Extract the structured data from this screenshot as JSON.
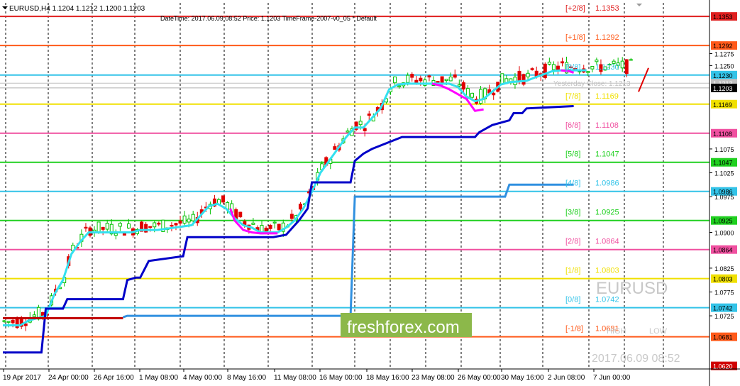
{
  "header": {
    "symbol_line": "EURUSD,H4  1.1204 1.1212 1.1200 1.1203",
    "info_line": "DateTime: 2017.06.09 08:52    Price: 1.1203    TimeFrame-2007-v0_05    *    Default"
  },
  "watermark": {
    "symbol": "EURUSD",
    "high_label": "HIGH",
    "low_label": "LOW",
    "datetime": "2017.06.09 08:52",
    "brand": "freshforex.com"
  },
  "colors": {
    "background": "#ffffff",
    "candle_up": "#00c000",
    "candle_down": "#e00000",
    "cyan_line": "#33e0f0",
    "magenta_line": "#ff00ff",
    "navy_line": "#0000c8",
    "mid_blue_line": "#3090e0",
    "red_line": "#c00000",
    "brand_bg": "#8cb84a"
  },
  "chart_data": {
    "type": "candlestick",
    "symbol": "EURUSD",
    "timeframe": "H4",
    "ylim": [
      1.062,
      1.1365
    ],
    "y_ticks": [
      "1.1353",
      "1.1275",
      "1.1250",
      "1.1213",
      "1.1203",
      "1.1169",
      "1.1108",
      "1.1075",
      "1.1047",
      "1.1025",
      "1.0986",
      "1.0975",
      "1.0925",
      "1.0900",
      "1.0864",
      "1.0825",
      "1.0803",
      "1.0775",
      "1.0742",
      "1.0725",
      "1.0681",
      "1.0620"
    ],
    "x_labels": [
      "19 Apr 2017",
      "24 Apr 00:00",
      "26 Apr 16:00",
      "1 May 08:00",
      "4 May 00:00",
      "8 May 16:00",
      "11 May 08:00",
      "16 May 00:00",
      "18 May 16:00",
      "23 May 08:00",
      "26 May 00:00",
      "30 May 16:00",
      "2 Jun 08:00",
      "7 Jun 00:00"
    ],
    "murrey_levels": [
      {
        "label": "[+2/8]",
        "value": "1.1353",
        "price": 1.1353,
        "color": "#e02020"
      },
      {
        "label": "[+1/8]",
        "value": "1.1292",
        "price": 1.1292,
        "color": "#ff5a1a"
      },
      {
        "label": "[8/8]",
        "value": "1.1230",
        "price": 1.123,
        "color": "#33c3e8"
      },
      {
        "label": "[7/8]",
        "value": "1.1169",
        "price": 1.1169,
        "color": "#f0e000"
      },
      {
        "label": "[6/8]",
        "value": "1.1108",
        "price": 1.1108,
        "color": "#f050a0"
      },
      {
        "label": "[5/8]",
        "value": "1.1047",
        "price": 1.1047,
        "color": "#20d020"
      },
      {
        "label": "[4/8]",
        "value": "1.0986",
        "price": 1.0986,
        "color": "#33c3e8"
      },
      {
        "label": "[3/8]",
        "value": "1.0925",
        "price": 1.0925,
        "color": "#20d020"
      },
      {
        "label": "[2/8]",
        "value": "1.0864",
        "price": 1.0864,
        "color": "#f050a0"
      },
      {
        "label": "[1/8]",
        "value": "1.0803",
        "price": 1.0803,
        "color": "#f0e000"
      },
      {
        "label": "[0/8]",
        "value": "1.0742",
        "price": 1.0742,
        "color": "#33c3e8"
      },
      {
        "label": "[-1/8]",
        "value": "1.0681",
        "price": 1.0681,
        "color": "#ff5a1a"
      }
    ],
    "yesterday_close_label": "Yesterday Close: 1.1213",
    "yesterday_close": 1.1213,
    "current_price": 1.1203,
    "series": [
      {
        "color_key": "cyan_line",
        "points": [
          [
            0,
            1.0705
          ],
          [
            4,
            1.0705
          ],
          [
            6,
            1.0715
          ],
          [
            8,
            1.072
          ],
          [
            10,
            1.0725
          ],
          [
            12,
            1.077
          ],
          [
            14,
            1.08
          ],
          [
            16,
            1.0855
          ],
          [
            18,
            1.088
          ],
          [
            20,
            1.09
          ],
          [
            22,
            1.09
          ],
          [
            30,
            1.09
          ],
          [
            32,
            1.0905
          ],
          [
            36,
            1.0905
          ],
          [
            40,
            1.091
          ],
          [
            44,
            1.0915
          ],
          [
            46,
            1.0935
          ],
          [
            48,
            1.0955
          ],
          [
            50,
            1.096
          ],
          [
            52,
            1.095
          ],
          [
            54,
            1.093
          ],
          [
            56,
            1.0915
          ],
          [
            58,
            1.091
          ],
          [
            60,
            1.09
          ],
          [
            64,
            1.09
          ],
          [
            66,
            1.091
          ],
          [
            68,
            1.0925
          ],
          [
            70,
            1.095
          ],
          [
            72,
            1.0985
          ],
          [
            74,
            1.1025
          ],
          [
            76,
            1.105
          ],
          [
            78,
            1.1075
          ],
          [
            80,
            1.11
          ],
          [
            82,
            1.112
          ],
          [
            84,
            1.112
          ],
          [
            86,
            1.114
          ],
          [
            88,
            1.116
          ],
          [
            90,
            1.12
          ],
          [
            92,
            1.121
          ],
          [
            94,
            1.1212
          ],
          [
            100,
            1.1212
          ],
          [
            104,
            1.1212
          ],
          [
            106,
            1.1205
          ],
          [
            108,
            1.1185
          ],
          [
            110,
            1.1175
          ],
          [
            112,
            1.118
          ],
          [
            116,
            1.121
          ],
          [
            118,
            1.1215
          ],
          [
            122,
            1.1218
          ],
          [
            124,
            1.1225
          ],
          [
            128,
            1.1238
          ],
          [
            130,
            1.124
          ],
          [
            136,
            1.124
          ]
        ]
      },
      {
        "color_key": "magenta_line",
        "points": [
          [
            53,
            1.095
          ],
          [
            54,
            1.0925
          ],
          [
            56,
            1.0905
          ],
          [
            58,
            1.09
          ],
          [
            60,
            1.0898
          ],
          [
            64,
            1.0898
          ],
          [
            100,
            1.1212
          ],
          [
            102,
            1.1208
          ],
          [
            104,
            1.12
          ],
          [
            106,
            1.119
          ],
          [
            108,
            1.118
          ],
          [
            110,
            1.1155
          ],
          [
            112,
            1.1158
          ],
          [
            130,
            1.124
          ],
          [
            132,
            1.1238
          ],
          [
            133,
            1.1235
          ]
        ]
      },
      {
        "color_key": "navy_line",
        "points": [
          [
            0,
            1.0648
          ],
          [
            9,
            1.0648
          ],
          [
            10,
            1.074
          ],
          [
            14,
            1.074
          ],
          [
            15,
            1.076
          ],
          [
            28,
            1.076
          ],
          [
            29,
            1.08
          ],
          [
            31,
            1.0805
          ],
          [
            32,
            1.0805
          ],
          [
            34,
            1.084
          ],
          [
            42,
            1.085
          ],
          [
            43,
            1.089
          ],
          [
            63,
            1.089
          ],
          [
            66,
            1.0895
          ],
          [
            67,
            1.0905
          ],
          [
            69,
            1.0925
          ],
          [
            71,
            1.095
          ],
          [
            72,
            1.1005
          ],
          [
            81,
            1.1005
          ],
          [
            82,
            1.105
          ],
          [
            84,
            1.1065
          ],
          [
            86,
            1.1075
          ],
          [
            93,
            1.11
          ],
          [
            110,
            1.11
          ],
          [
            111,
            1.111
          ],
          [
            114,
            1.1125
          ],
          [
            118,
            1.1135
          ],
          [
            119,
            1.115
          ],
          [
            121,
            1.115
          ],
          [
            122,
            1.116
          ],
          [
            133,
            1.1165
          ]
        ]
      },
      {
        "color_key": "mid_blue_line",
        "points": [
          [
            28,
            1.0722
          ],
          [
            29,
            1.0725
          ],
          [
            81,
            1.0725
          ],
          [
            82,
            1.0975
          ],
          [
            117,
            1.0975
          ],
          [
            118,
            1.1
          ],
          [
            133,
            1.1
          ]
        ]
      },
      {
        "color_key": "red_line",
        "points": [
          [
            0,
            1.072
          ],
          [
            28,
            1.072
          ]
        ]
      }
    ]
  }
}
